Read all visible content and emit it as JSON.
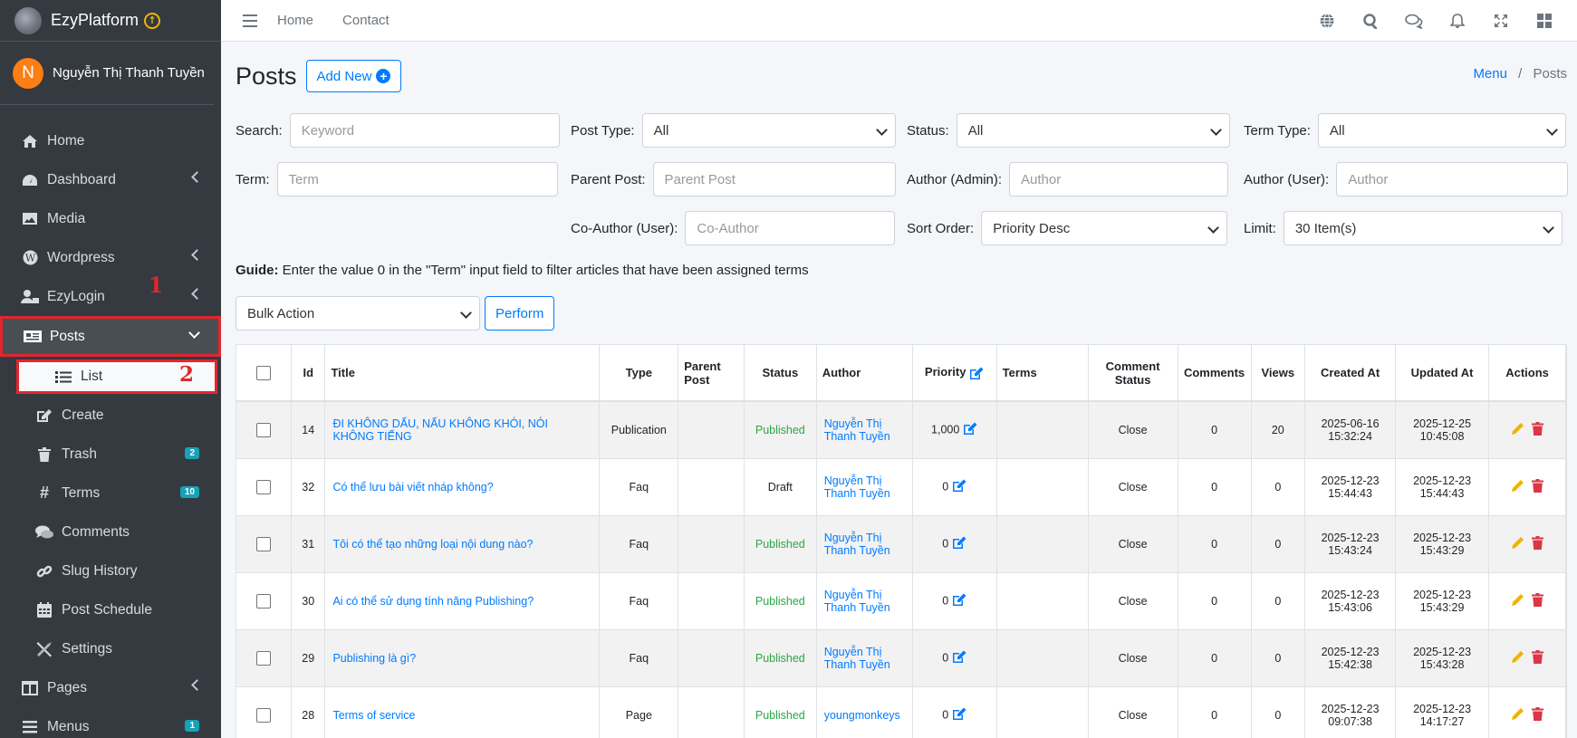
{
  "brand": {
    "name": "EzyPlatform"
  },
  "user": {
    "initial": "N",
    "name": "Nguyễn Thị Thanh Tuyền"
  },
  "sidebar": {
    "items": [
      {
        "label": "Home"
      },
      {
        "label": "Dashboard"
      },
      {
        "label": "Media"
      },
      {
        "label": "Wordpress"
      },
      {
        "label": "EzyLogin"
      },
      {
        "label": "Posts"
      },
      {
        "label": "List"
      },
      {
        "label": "Create"
      },
      {
        "label": "Trash",
        "badge": "2"
      },
      {
        "label": "Terms",
        "badge": "10"
      },
      {
        "label": "Comments"
      },
      {
        "label": "Slug History"
      },
      {
        "label": "Post Schedule"
      },
      {
        "label": "Settings"
      },
      {
        "label": "Pages"
      },
      {
        "label": "Menus",
        "badge": "1"
      }
    ],
    "annotations": [
      "1",
      "2"
    ]
  },
  "topbar": {
    "links": [
      "Home",
      "Contact"
    ],
    "icons": [
      "globe-icon",
      "search-icon",
      "comments-icon",
      "bell-icon",
      "expand-icon",
      "grid-icon"
    ]
  },
  "page": {
    "title": "Posts",
    "add_new": "Add New",
    "breadcrumb": [
      "Menu",
      "/",
      "Posts"
    ]
  },
  "filters": {
    "search": {
      "label": "Search:",
      "placeholder": "Keyword"
    },
    "post_type": {
      "label": "Post Type:",
      "value": "All"
    },
    "status": {
      "label": "Status:",
      "value": "All"
    },
    "term_type": {
      "label": "Term Type:",
      "value": "All"
    },
    "term": {
      "label": "Term:",
      "placeholder": "Term"
    },
    "parent_post": {
      "label": "Parent Post:",
      "placeholder": "Parent Post"
    },
    "author_admin": {
      "label": "Author (Admin):",
      "placeholder": "Author"
    },
    "author_user": {
      "label": "Author (User):",
      "placeholder": "Author"
    },
    "co_author": {
      "label": "Co-Author (User):",
      "placeholder": "Co-Author"
    },
    "sort_order": {
      "label": "Sort Order:",
      "value": "Priority Desc"
    },
    "limit": {
      "label": "Limit:",
      "value": "30 Item(s)"
    }
  },
  "guide": {
    "bold": "Guide:",
    "text": " Enter the value 0 in the \"Term\" input field to filter articles that have been assigned terms"
  },
  "bulk": {
    "value": "Bulk Action",
    "perform": "Perform"
  },
  "table": {
    "headers": [
      "Id",
      "Title",
      "Type",
      "Parent Post",
      "Status",
      "Author",
      "Priority",
      "Terms",
      "Comment Status",
      "Comments",
      "Views",
      "Created At",
      "Updated At",
      "Actions"
    ],
    "rows": [
      {
        "id": "14",
        "title": "ĐI KHÔNG DẤU, NẤU KHÔNG KHÓI, NÓI KHÔNG TIẾNG",
        "type": "Publication",
        "parent": "",
        "status": "Published",
        "author": "Nguyễn Thị Thanh Tuyền",
        "priority": "1,000",
        "terms": "",
        "comment_status": "Close",
        "comments": "0",
        "views": "20",
        "created": "2025-06-16 15:32:24",
        "updated": "2025-12-25 10:45:08"
      },
      {
        "id": "32",
        "title": "Có thể lưu bài viết nháp không?",
        "type": "Faq",
        "parent": "",
        "status": "Draft",
        "author": "Nguyễn Thị Thanh Tuyền",
        "priority": "0",
        "terms": "",
        "comment_status": "Close",
        "comments": "0",
        "views": "0",
        "created": "2025-12-23 15:44:43",
        "updated": "2025-12-23 15:44:43"
      },
      {
        "id": "31",
        "title": "Tôi có thể tạo những loại nội dung nào?",
        "type": "Faq",
        "parent": "",
        "status": "Published",
        "author": "Nguyễn Thị Thanh Tuyền",
        "priority": "0",
        "terms": "",
        "comment_status": "Close",
        "comments": "0",
        "views": "0",
        "created": "2025-12-23 15:43:24",
        "updated": "2025-12-23 15:43:29"
      },
      {
        "id": "30",
        "title": "Ai có thể sử dụng tính năng Publishing?",
        "type": "Faq",
        "parent": "",
        "status": "Published",
        "author": "Nguyễn Thị Thanh Tuyền",
        "priority": "0",
        "terms": "",
        "comment_status": "Close",
        "comments": "0",
        "views": "0",
        "created": "2025-12-23 15:43:06",
        "updated": "2025-12-23 15:43:29"
      },
      {
        "id": "29",
        "title": "Publishing là gì?",
        "type": "Faq",
        "parent": "",
        "status": "Published",
        "author": "Nguyễn Thị Thanh Tuyền",
        "priority": "0",
        "terms": "",
        "comment_status": "Close",
        "comments": "0",
        "views": "0",
        "created": "2025-12-23 15:42:38",
        "updated": "2025-12-23 15:43:28"
      },
      {
        "id": "28",
        "title": "Terms of service",
        "type": "Page",
        "parent": "",
        "status": "Published",
        "author": "youngmonkeys",
        "priority": "0",
        "terms": "",
        "comment_status": "Close",
        "comments": "0",
        "views": "0",
        "created": "2025-12-23 09:07:38",
        "updated": "2025-12-23 14:17:27"
      }
    ]
  },
  "colors": {
    "sidebar": "#343a40",
    "primary": "#007bff",
    "published": "#28a745",
    "annotation": "#e3262e",
    "edit": "#f0b400",
    "delete": "#dc3545"
  }
}
